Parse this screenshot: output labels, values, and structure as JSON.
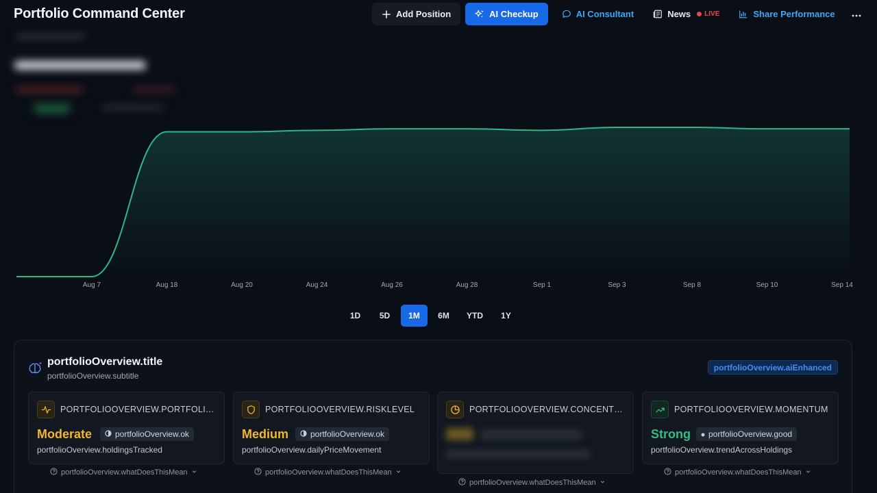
{
  "header": {
    "title": "Portfolio Command Center",
    "buttons": {
      "add_position": "Add Position",
      "ai_checkup": "AI Checkup",
      "ai_consultant": "AI Consultant",
      "news": "News",
      "live": "LIVE",
      "share_performance": "Share Performance"
    }
  },
  "colors": {
    "background": "#0a0e17",
    "accent_blue": "#1769e8",
    "link_blue": "#3ea8f4",
    "chart_line": "#2bb98a",
    "live_red": "#e5484d",
    "moderate": "#f2b630",
    "medium": "#f2b630",
    "strong": "#2fbf85"
  },
  "chart_data": {
    "type": "area",
    "x": [
      "Aug 7",
      "Aug 18",
      "Aug 20",
      "Aug 24",
      "Aug 26",
      "Aug 28",
      "Sep 1",
      "Sep 3",
      "Sep 8",
      "Sep 10",
      "Sep 14"
    ],
    "values": [
      0,
      97,
      97,
      98,
      99,
      99,
      98,
      100,
      100,
      99,
      99
    ],
    "xlabel": "",
    "ylabel": "",
    "grid": false
  },
  "ranges": [
    "1D",
    "5D",
    "1M",
    "6M",
    "YTD",
    "1Y"
  ],
  "active_range": "1M",
  "overview": {
    "title": "portfolioOverview.title",
    "subtitle": "portfolioOverview.subtitle",
    "badge": "portfolioOverview.aiEnhanced",
    "cards": [
      {
        "label": "PORTFOLIOOVERVIEW.PORTFOLIOH...",
        "value": "Moderate",
        "chip": "portfolioOverview.ok",
        "desc": "portfolioOverview.holdingsTracked",
        "link": "portfolioOverview.whatDoesThisMean"
      },
      {
        "label": "PORTFOLIOOVERVIEW.RISKLEVEL",
        "value": "Medium",
        "chip": "portfolioOverview.ok",
        "desc": "portfolioOverview.dailyPriceMovement",
        "link": "portfolioOverview.whatDoesThisMean"
      },
      {
        "label": "PORTFOLIOOVERVIEW.CONCENTRA...",
        "value": "",
        "chip": "",
        "desc": "",
        "link": "portfolioOverview.whatDoesThisMean"
      },
      {
        "label": "PORTFOLIOOVERVIEW.MOMENTUM",
        "value": "Strong",
        "chip": "portfolioOverview.good",
        "desc": "portfolioOverview.trendAcrossHoldings",
        "link": "portfolioOverview.whatDoesThisMean"
      }
    ]
  }
}
